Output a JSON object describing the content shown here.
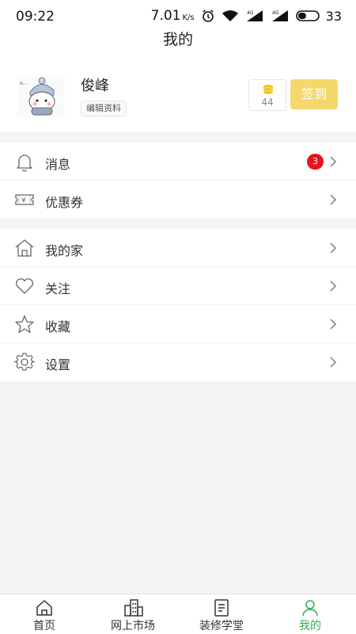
{
  "status_bar": {
    "time": "09:22",
    "speed": "7.01",
    "speed_unit": "K/s",
    "battery_level": "33"
  },
  "nav": {
    "title": "我的"
  },
  "profile": {
    "username": "俊峰",
    "edit_label": "编辑资料",
    "points": "44",
    "checkin_label": "签到",
    "checkin_color": "#f5d86b"
  },
  "menu_group1": [
    {
      "label": "消息",
      "icon": "bell-icon",
      "badge": "3"
    },
    {
      "label": "优惠券",
      "icon": "coupon-icon"
    }
  ],
  "menu_group2": [
    {
      "label": "我的家",
      "icon": "home-icon"
    },
    {
      "label": "关注",
      "icon": "heart-icon"
    },
    {
      "label": "收藏",
      "icon": "star-icon"
    },
    {
      "label": "设置",
      "icon": "settings-icon"
    }
  ],
  "tabs": [
    {
      "label": "首页",
      "icon": "home-tab-icon"
    },
    {
      "label": "网上市场",
      "icon": "building-icon"
    },
    {
      "label": "装修学堂",
      "icon": "document-icon"
    },
    {
      "label": "我的",
      "icon": "user-icon",
      "active": true
    }
  ],
  "colors": {
    "accent": "#2bb24c",
    "badge": "#e8141b"
  }
}
